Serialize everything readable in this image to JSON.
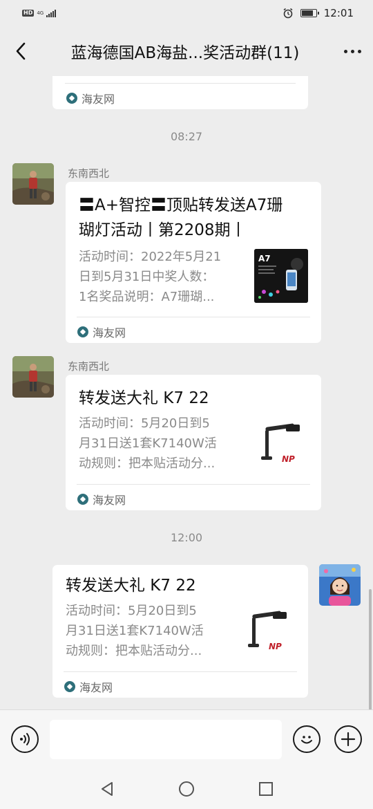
{
  "status_bar": {
    "hd_badge": "HD",
    "network": "4G",
    "time": "12:01",
    "icons": [
      "signal-icon",
      "alarm-icon",
      "battery-icon"
    ]
  },
  "header": {
    "title": "蓝海德国AB海盐...奖活动群(11)",
    "back_icon": "back-arrow-icon",
    "more_icon": "more-icon"
  },
  "chat": {
    "partial_card": {
      "source": "海友网"
    },
    "timestamp_1": "08:27",
    "message_1": {
      "sender": "东南西北",
      "title_line_1": "〓A+智控〓顶贴转发送A7珊",
      "title_line_2": "瑚灯活动丨第2208期丨",
      "desc_line_1": "活动时间：2022年5月21",
      "desc_line_2": "日到5月31日中奖人数：",
      "desc_line_3": "1名奖品说明：A7珊瑚...",
      "thumb_label": "A7",
      "source": "海友网"
    },
    "message_2": {
      "sender": "东南西北",
      "title": "转发送大礼 K7 22",
      "desc_line_1": "活动时间：5月20日到5",
      "desc_line_2": "月31日送1套K7140W活",
      "desc_line_3": "动规则：把本贴活动分...",
      "thumb_label": "NP",
      "source": "海友网"
    },
    "timestamp_2": "12:00",
    "message_3": {
      "title": "转发送大礼 K7 22",
      "desc_line_1": "活动时间：5月20日到5",
      "desc_line_2": "月31日送1套K7140W活",
      "desc_line_3": "动规则：把本贴活动分...",
      "thumb_label": "NP",
      "source": "海友网"
    }
  },
  "input_bar": {
    "voice_icon": "voice-icon",
    "input_value": "",
    "emoji_icon": "emoji-icon",
    "plus_icon": "plus-icon"
  },
  "nav_bar": {
    "icons": [
      "nav-back-icon",
      "nav-home-icon",
      "nav-recents-icon"
    ]
  },
  "colors": {
    "background": "#ededed",
    "card": "#ffffff",
    "meta_text": "#8a8a8a",
    "source_icon": "#2e6f7a"
  }
}
